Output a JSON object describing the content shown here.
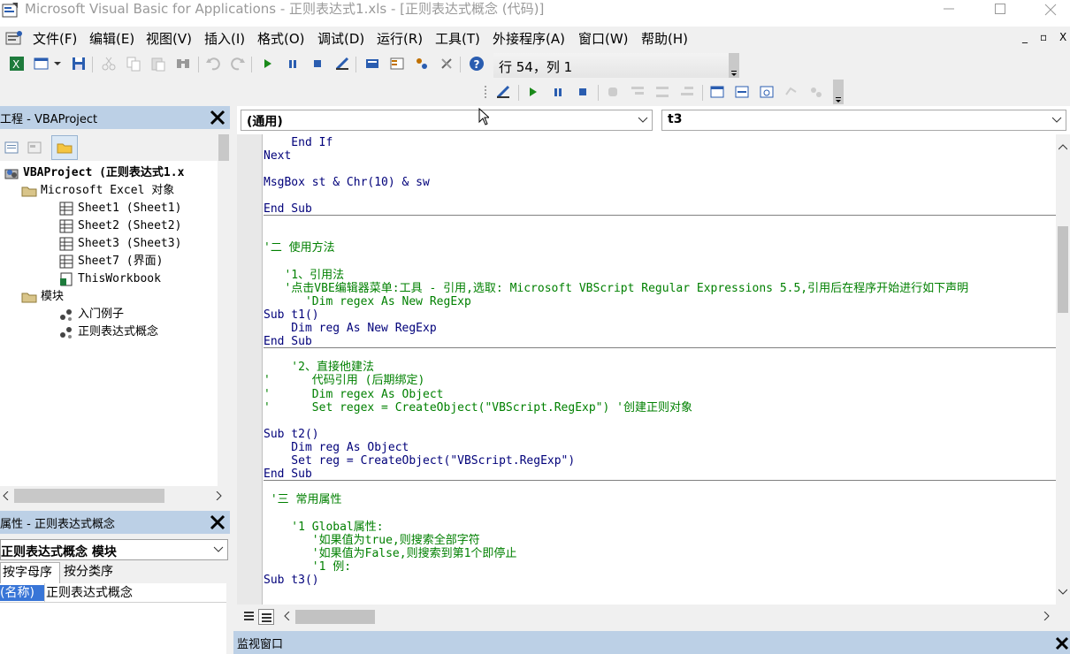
{
  "window": {
    "title": "Microsoft Visual Basic for Applications - 正则表达式1.xls - [正则表达式概念 (代码)]"
  },
  "menu": [
    "文件(F)",
    "编辑(E)",
    "视图(V)",
    "插入(I)",
    "格式(O)",
    "调试(D)",
    "运行(R)",
    "工具(T)",
    "外接程序(A)",
    "窗口(W)",
    "帮助(H)"
  ],
  "mdi_controls": [
    "_",
    "▫",
    "X"
  ],
  "position_readout": "行 54，列 1",
  "project": {
    "pane_title": "工程 - VBAProject",
    "tree": [
      {
        "label": "VBAProject (正则表达式1.x",
        "icon": "vba-project-icon"
      },
      {
        "label": "Microsoft Excel 对象",
        "icon": "folder-open-icon"
      },
      {
        "label": "Sheet1 (Sheet1)",
        "icon": "worksheet-icon"
      },
      {
        "label": "Sheet2 (Sheet2)",
        "icon": "worksheet-icon"
      },
      {
        "label": "Sheet3 (Sheet3)",
        "icon": "worksheet-icon"
      },
      {
        "label": "Sheet7 (界面)",
        "icon": "worksheet-icon"
      },
      {
        "label": "ThisWorkbook",
        "icon": "workbook-icon"
      },
      {
        "label": "模块",
        "icon": "folder-open-icon"
      },
      {
        "label": "入门例子",
        "icon": "module-icon"
      },
      {
        "label": "正则表达式概念",
        "icon": "module-icon"
      }
    ]
  },
  "properties": {
    "pane_title": "属性 - 正则表达式概念",
    "object_select": "正则表达式概念 模块",
    "tabs": [
      "按字母序",
      "按分类序"
    ],
    "name_key": "(名称)",
    "name_value": "正则表达式概念"
  },
  "code_window": {
    "object_combo": "(通用)",
    "procedure_combo": "t3",
    "lines": [
      {
        "text": "    End If",
        "style": "kw"
      },
      {
        "text": "Next",
        "style": "kw"
      },
      {
        "text": "",
        "style": "kw"
      },
      {
        "text": "MsgBox st & Chr(10) & sw",
        "style": "kw"
      },
      {
        "text": "",
        "style": "kw"
      },
      {
        "text": "End Sub",
        "style": "kw"
      },
      {
        "text": "",
        "style": "kw"
      },
      {
        "text": "",
        "style": "kw"
      },
      {
        "text": "'二 使用方法",
        "style": "cm"
      },
      {
        "text": "",
        "style": "kw"
      },
      {
        "text": "   '1、引用法",
        "style": "cm"
      },
      {
        "text": "   '点击VBE编辑器菜单:工具 - 引用,选取: Microsoft VBScript Regular Expressions 5.5,引用后在程序开始进行如下声明",
        "style": "cm"
      },
      {
        "text": "      'Dim regex As New RegExp",
        "style": "cm"
      },
      {
        "text": "Sub t1()",
        "style": "kw"
      },
      {
        "text": "    Dim reg As New RegExp",
        "style": "kw"
      },
      {
        "text": "End Sub",
        "style": "kw"
      },
      {
        "text": "",
        "style": "kw"
      },
      {
        "text": "    '2、直接他建法",
        "style": "cm"
      },
      {
        "text": "'      代码引用 (后期绑定)",
        "style": "cm"
      },
      {
        "text": "'      Dim regex As Object",
        "style": "cm"
      },
      {
        "text": "'      Set regex = CreateObject(\"VBScript.RegExp\") '创建正则对象",
        "style": "cm"
      },
      {
        "text": "",
        "style": "kw"
      },
      {
        "text": "Sub t2()",
        "style": "kw"
      },
      {
        "text": "    Dim reg As Object",
        "style": "kw"
      },
      {
        "text": "    Set reg = CreateObject(\"VBScript.RegExp\")",
        "style": "kw"
      },
      {
        "text": "End Sub",
        "style": "kw"
      },
      {
        "text": "",
        "style": "kw"
      },
      {
        "text": " '三 常用属性",
        "style": "cm"
      },
      {
        "text": "",
        "style": "kw"
      },
      {
        "text": "    '1 Global属性:",
        "style": "cm"
      },
      {
        "text": "       '如果值为true,则搜索全部字符",
        "style": "cm"
      },
      {
        "text": "       '如果值为False,则搜索到第1个即停止",
        "style": "cm"
      },
      {
        "text": "       '1 例:",
        "style": "cm"
      },
      {
        "text": "Sub t3()",
        "style": "kw"
      }
    ]
  },
  "watch_window": {
    "title": "监视窗口"
  },
  "colors": {
    "keyword": "#00007a",
    "comment": "#008000",
    "pane_title_bg": "#bcd0e6",
    "selection": "#3875d7"
  }
}
